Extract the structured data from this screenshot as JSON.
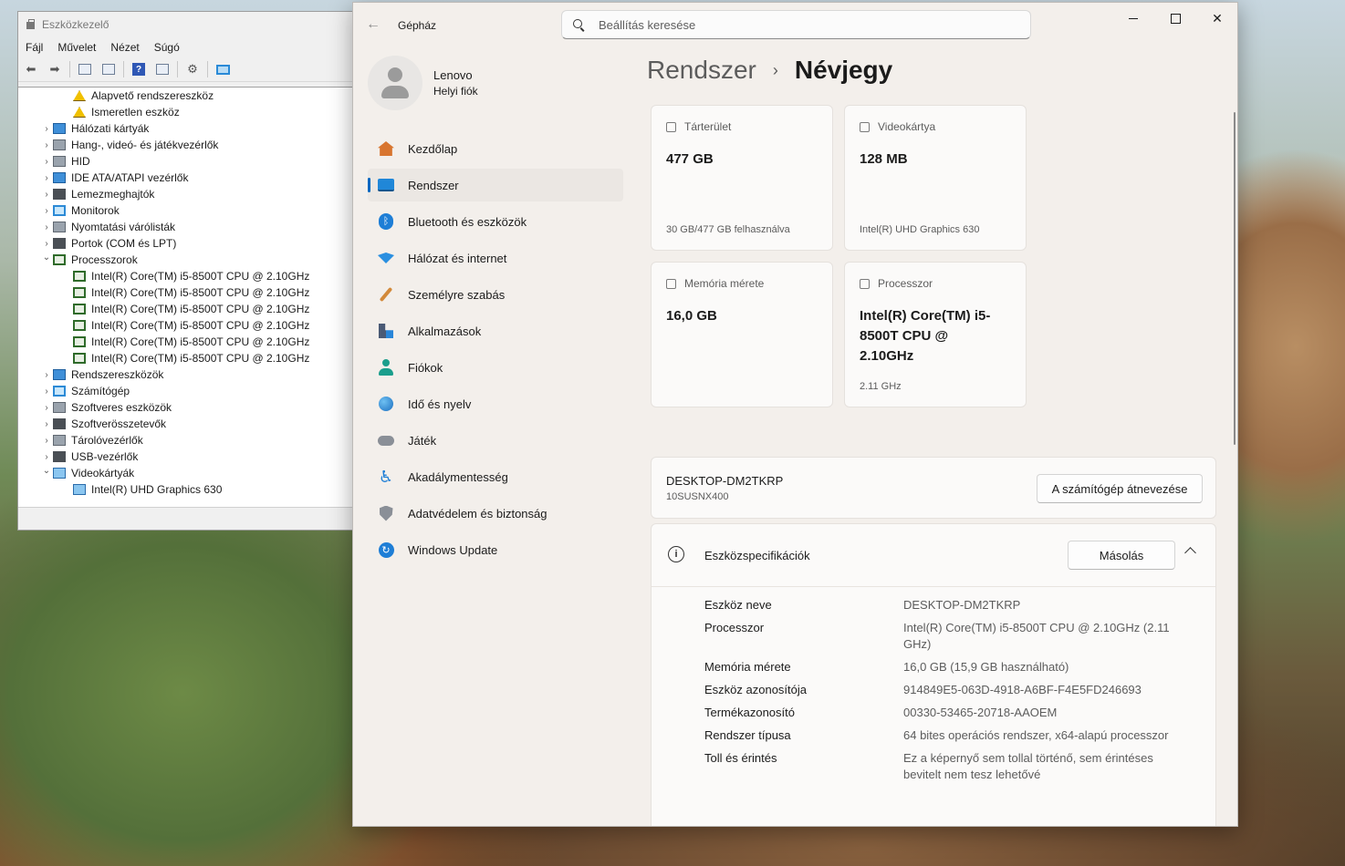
{
  "device_manager": {
    "title": "Eszközkezelő",
    "menu": [
      "Fájl",
      "Művelet",
      "Nézet",
      "Súgó"
    ],
    "tree": [
      {
        "label": "Alapvető rendszereszköz",
        "indent": 2,
        "icon": "warning-device-icon",
        "expander": ""
      },
      {
        "label": "Ismeretlen eszköz",
        "indent": 2,
        "icon": "warning-device-icon",
        "expander": ""
      },
      {
        "label": "Hálózati kártyák",
        "indent": 1,
        "icon": "network-adapter-icon",
        "expander": ">"
      },
      {
        "label": "Hang-, videó- és játékvezérlők",
        "indent": 1,
        "icon": "speaker-icon",
        "expander": ">"
      },
      {
        "label": "HID",
        "indent": 1,
        "icon": "keyboard-icon",
        "expander": ">"
      },
      {
        "label": "IDE ATA/ATAPI vezérlők",
        "indent": 1,
        "icon": "ide-controller-icon",
        "expander": ">"
      },
      {
        "label": "Lemezmeghajtók",
        "indent": 1,
        "icon": "disk-drive-icon",
        "expander": ">"
      },
      {
        "label": "Monitorok",
        "indent": 1,
        "icon": "monitor-icon",
        "expander": ">"
      },
      {
        "label": "Nyomtatási várólisták",
        "indent": 1,
        "icon": "printer-icon",
        "expander": ">"
      },
      {
        "label": "Portok (COM és LPT)",
        "indent": 1,
        "icon": "port-icon",
        "expander": ">"
      },
      {
        "label": "Processzorok",
        "indent": 1,
        "icon": "processor-icon",
        "expander": "v"
      },
      {
        "label": "Intel(R) Core(TM) i5-8500T CPU @ 2.10GHz",
        "indent": 2,
        "icon": "processor-icon",
        "expander": ""
      },
      {
        "label": "Intel(R) Core(TM) i5-8500T CPU @ 2.10GHz",
        "indent": 2,
        "icon": "processor-icon",
        "expander": ""
      },
      {
        "label": "Intel(R) Core(TM) i5-8500T CPU @ 2.10GHz",
        "indent": 2,
        "icon": "processor-icon",
        "expander": ""
      },
      {
        "label": "Intel(R) Core(TM) i5-8500T CPU @ 2.10GHz",
        "indent": 2,
        "icon": "processor-icon",
        "expander": ""
      },
      {
        "label": "Intel(R) Core(TM) i5-8500T CPU @ 2.10GHz",
        "indent": 2,
        "icon": "processor-icon",
        "expander": ""
      },
      {
        "label": "Intel(R) Core(TM) i5-8500T CPU @ 2.10GHz",
        "indent": 2,
        "icon": "processor-icon",
        "expander": ""
      },
      {
        "label": "Rendszereszközök",
        "indent": 1,
        "icon": "system-device-icon",
        "expander": ">"
      },
      {
        "label": "Számítógép",
        "indent": 1,
        "icon": "computer-icon",
        "expander": ">"
      },
      {
        "label": "Szoftveres eszközök",
        "indent": 1,
        "icon": "software-device-icon",
        "expander": ">"
      },
      {
        "label": "Szoftverösszetevők",
        "indent": 1,
        "icon": "software-component-icon",
        "expander": ">"
      },
      {
        "label": "Tárolóvezérlők",
        "indent": 1,
        "icon": "storage-controller-icon",
        "expander": ">"
      },
      {
        "label": "USB-vezérlők",
        "indent": 1,
        "icon": "usb-icon",
        "expander": ">"
      },
      {
        "label": "Videokártyák",
        "indent": 1,
        "icon": "display-adapter-icon",
        "expander": "v"
      },
      {
        "label": "Intel(R) UHD Graphics 630",
        "indent": 2,
        "icon": "display-adapter-icon",
        "expander": ""
      }
    ]
  },
  "settings": {
    "app_title": "Gépház",
    "search_placeholder": "Beállítás keresése",
    "profile": {
      "name": "Lenovo",
      "account": "Helyi fiók"
    },
    "nav": [
      {
        "label": "Kezdőlap",
        "icon": "home-icon",
        "active": false
      },
      {
        "label": "Rendszer",
        "icon": "system-icon",
        "active": true
      },
      {
        "label": "Bluetooth és eszközök",
        "icon": "bluetooth-icon",
        "active": false
      },
      {
        "label": "Hálózat és internet",
        "icon": "wifi-icon",
        "active": false
      },
      {
        "label": "Személyre szabás",
        "icon": "brush-icon",
        "active": false
      },
      {
        "label": "Alkalmazások",
        "icon": "apps-icon",
        "active": false
      },
      {
        "label": "Fiókok",
        "icon": "accounts-icon",
        "active": false
      },
      {
        "label": "Idő és nyelv",
        "icon": "globe-clock-icon",
        "active": false
      },
      {
        "label": "Játék",
        "icon": "gamepad-icon",
        "active": false
      },
      {
        "label": "Akadálymentesség",
        "icon": "accessibility-icon",
        "active": false
      },
      {
        "label": "Adatvédelem és biztonság",
        "icon": "shield-icon",
        "active": false
      },
      {
        "label": "Windows Update",
        "icon": "update-icon",
        "active": false
      }
    ],
    "breadcrumb": {
      "parent": "Rendszer",
      "separator": "›",
      "current": "Névjegy"
    },
    "cards": {
      "storage": {
        "label": "Tárterület",
        "value": "477 GB",
        "sub": "30 GB/477 GB felhasználva"
      },
      "gpu": {
        "label": "Videokártya",
        "value": "128 MB",
        "sub": "Intel(R) UHD Graphics 630"
      },
      "memory": {
        "label": "Memória mérete",
        "value": "16,0 GB",
        "sub": ""
      },
      "cpu": {
        "label": "Processzor",
        "value": "Intel(R) Core(TM) i5-8500T CPU @ 2.10GHz",
        "sub": "2.11 GHz"
      }
    },
    "device": {
      "name": "DESKTOP-DM2TKRP",
      "model": "10SUSNX400",
      "rename_button": "A számítógép átnevezése"
    },
    "specs": {
      "title": "Eszközspecifikációk",
      "copy_button": "Másolás",
      "rows": [
        {
          "label": "Eszköz neve",
          "value": "DESKTOP-DM2TKRP"
        },
        {
          "label": "Processzor",
          "value": "Intel(R) Core(TM) i5-8500T CPU @ 2.10GHz (2.11 GHz)"
        },
        {
          "label": "Memória mérete",
          "value": "16,0 GB (15,9 GB használható)"
        },
        {
          "label": "Eszköz azonosítója",
          "value": "914849E5-063D-4918-A6BF-F4E5FD246693"
        },
        {
          "label": "Termékazonosító",
          "value": "00330-53465-20718-AAOEM"
        },
        {
          "label": "Rendszer típusa",
          "value": "64 bites operációs rendszer, x64-alapú processzor"
        },
        {
          "label": "Toll és érintés",
          "value": "Ez a képernyő sem tollal történő, sem érintéses bevitelt nem tesz lehetővé"
        }
      ]
    }
  }
}
